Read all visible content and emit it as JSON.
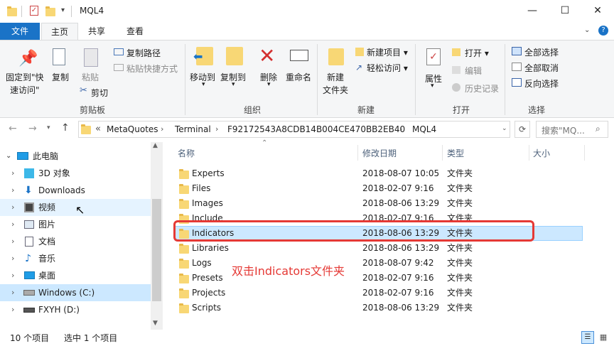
{
  "window": {
    "title": "MQL4",
    "minimize": "—",
    "maximize": "☐",
    "close": "✕"
  },
  "ribbon_tabs": [
    "文件",
    "主页",
    "共享",
    "查看"
  ],
  "clipboard": {
    "pin_label_line1": "固定到\"快",
    "pin_label_line2": "速访问\"",
    "copy": "复制",
    "paste": "粘贴",
    "copy_path": "复制路径",
    "paste_shortcut": "粘贴快捷方式",
    "cut": "剪切",
    "group": "剪贴板"
  },
  "organize": {
    "move_to": "移动到",
    "copy_to": "复制到",
    "delete": "删除",
    "rename": "重命名",
    "group": "组织"
  },
  "new": {
    "new_folder_line1": "新建",
    "new_folder_line2": "文件夹",
    "new_item": "新建项目 ▾",
    "easy_access": "轻松访问 ▾",
    "group": "新建"
  },
  "open": {
    "properties": "属性",
    "open": "打开 ▾",
    "edit": "编辑",
    "history": "历史记录",
    "group": "打开"
  },
  "select": {
    "select_all": "全部选择",
    "select_none": "全部取消",
    "invert": "反向选择",
    "group": "选择"
  },
  "address": {
    "overflow": "«",
    "crumbs": [
      "MetaQuotes",
      "Terminal",
      "F92172543A8CDB14B004CE470BB2EB40",
      "MQL4"
    ],
    "search_placeholder": "搜索\"MQ..."
  },
  "nav": {
    "items": [
      "此电脑",
      "3D 对象",
      "Downloads",
      "视频",
      "图片",
      "文档",
      "音乐",
      "桌面",
      "Windows (C:)",
      "FXYH (D:)"
    ]
  },
  "columns": {
    "name": "名称",
    "modified": "修改日期",
    "type": "类型",
    "size": "大小"
  },
  "files": [
    {
      "name": "Experts",
      "date": "2018-08-07 10:05",
      "type": "文件夹"
    },
    {
      "name": "Files",
      "date": "2018-02-07 9:16",
      "type": "文件夹"
    },
    {
      "name": "Images",
      "date": "2018-08-06 13:29",
      "type": "文件夹"
    },
    {
      "name": "Include",
      "date": "2018-02-07 9:16",
      "type": "文件夹"
    },
    {
      "name": "Indicators",
      "date": "2018-08-06 13:29",
      "type": "文件夹"
    },
    {
      "name": "Libraries",
      "date": "2018-08-06 13:29",
      "type": "文件夹"
    },
    {
      "name": "Logs",
      "date": "2018-08-07 9:42",
      "type": "文件夹"
    },
    {
      "name": "Presets",
      "date": "2018-02-07 9:16",
      "type": "文件夹"
    },
    {
      "name": "Projects",
      "date": "2018-02-07 9:16",
      "type": "文件夹"
    },
    {
      "name": "Scripts",
      "date": "2018-08-06 13:29",
      "type": "文件夹"
    }
  ],
  "annotation": "双击Indicators文件夹",
  "status": {
    "count": "10 个项目",
    "selected": "选中 1 个项目"
  },
  "colors": {
    "accent": "#1a73c7",
    "selection": "#cce8ff",
    "highlight_box": "#e53935",
    "annotation_text": "#e53935",
    "folder": "#f8d775"
  }
}
